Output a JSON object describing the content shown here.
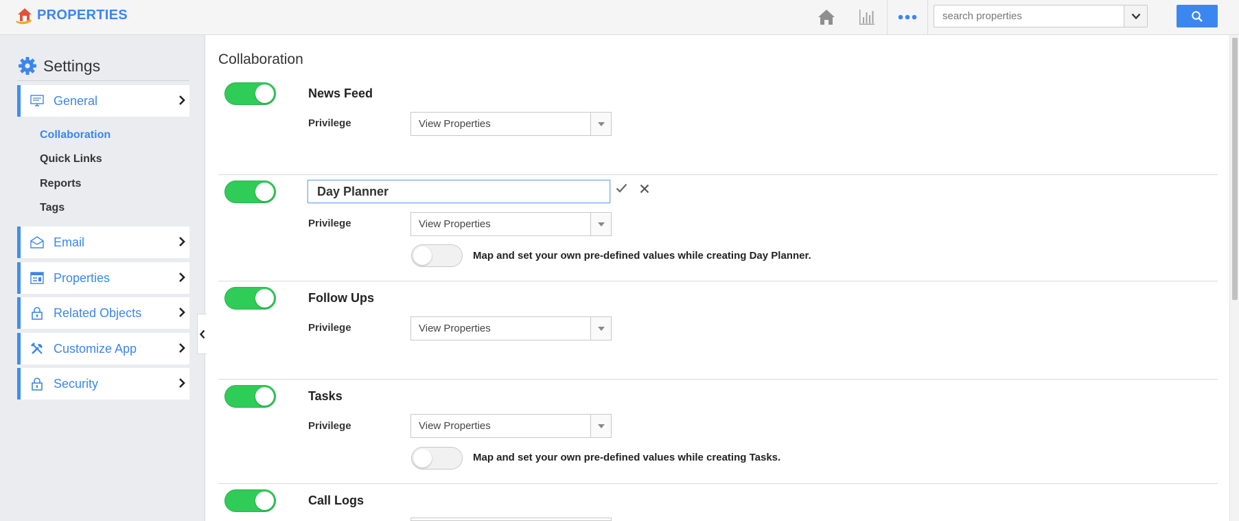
{
  "app": {
    "name": "PROPERTIES"
  },
  "search": {
    "placeholder": "search properties"
  },
  "colors": {
    "accent": "#3b86ee",
    "toggle_on": "#2fcc57",
    "search_button": "#3b87f0"
  },
  "topbar": {
    "icons": [
      "home-icon",
      "chart-icon",
      "more-icon"
    ]
  },
  "sidebar": {
    "title": "Settings",
    "items": [
      {
        "label": "General",
        "icon": "monitor-icon"
      },
      {
        "label": "Email",
        "icon": "envelope-icon"
      },
      {
        "label": "Properties",
        "icon": "form-icon"
      },
      {
        "label": "Related Objects",
        "icon": "lock-icon"
      },
      {
        "label": "Customize App",
        "icon": "tools-icon"
      },
      {
        "label": "Security",
        "icon": "lock-icon"
      }
    ],
    "subitems": [
      {
        "label": "Collaboration",
        "active": true
      },
      {
        "label": "Quick Links",
        "active": false
      },
      {
        "label": "Reports",
        "active": false
      },
      {
        "label": "Tags",
        "active": false
      }
    ]
  },
  "main": {
    "title": "Collaboration",
    "privilege_label": "Privilege",
    "sections": [
      {
        "name": "News Feed",
        "enabled": true,
        "privilege": "View Properties"
      },
      {
        "name": "Day Planner",
        "enabled": true,
        "editing": true,
        "privilege": "View Properties",
        "map_enabled": false,
        "map_text": "Map and set your own pre-defined values while creating Day Planner."
      },
      {
        "name": "Follow Ups",
        "enabled": true,
        "privilege": "View Properties"
      },
      {
        "name": "Tasks",
        "enabled": true,
        "privilege": "View Properties",
        "map_enabled": false,
        "map_text": "Map and set your own pre-defined values while creating Tasks."
      },
      {
        "name": "Call Logs",
        "enabled": true
      }
    ]
  }
}
